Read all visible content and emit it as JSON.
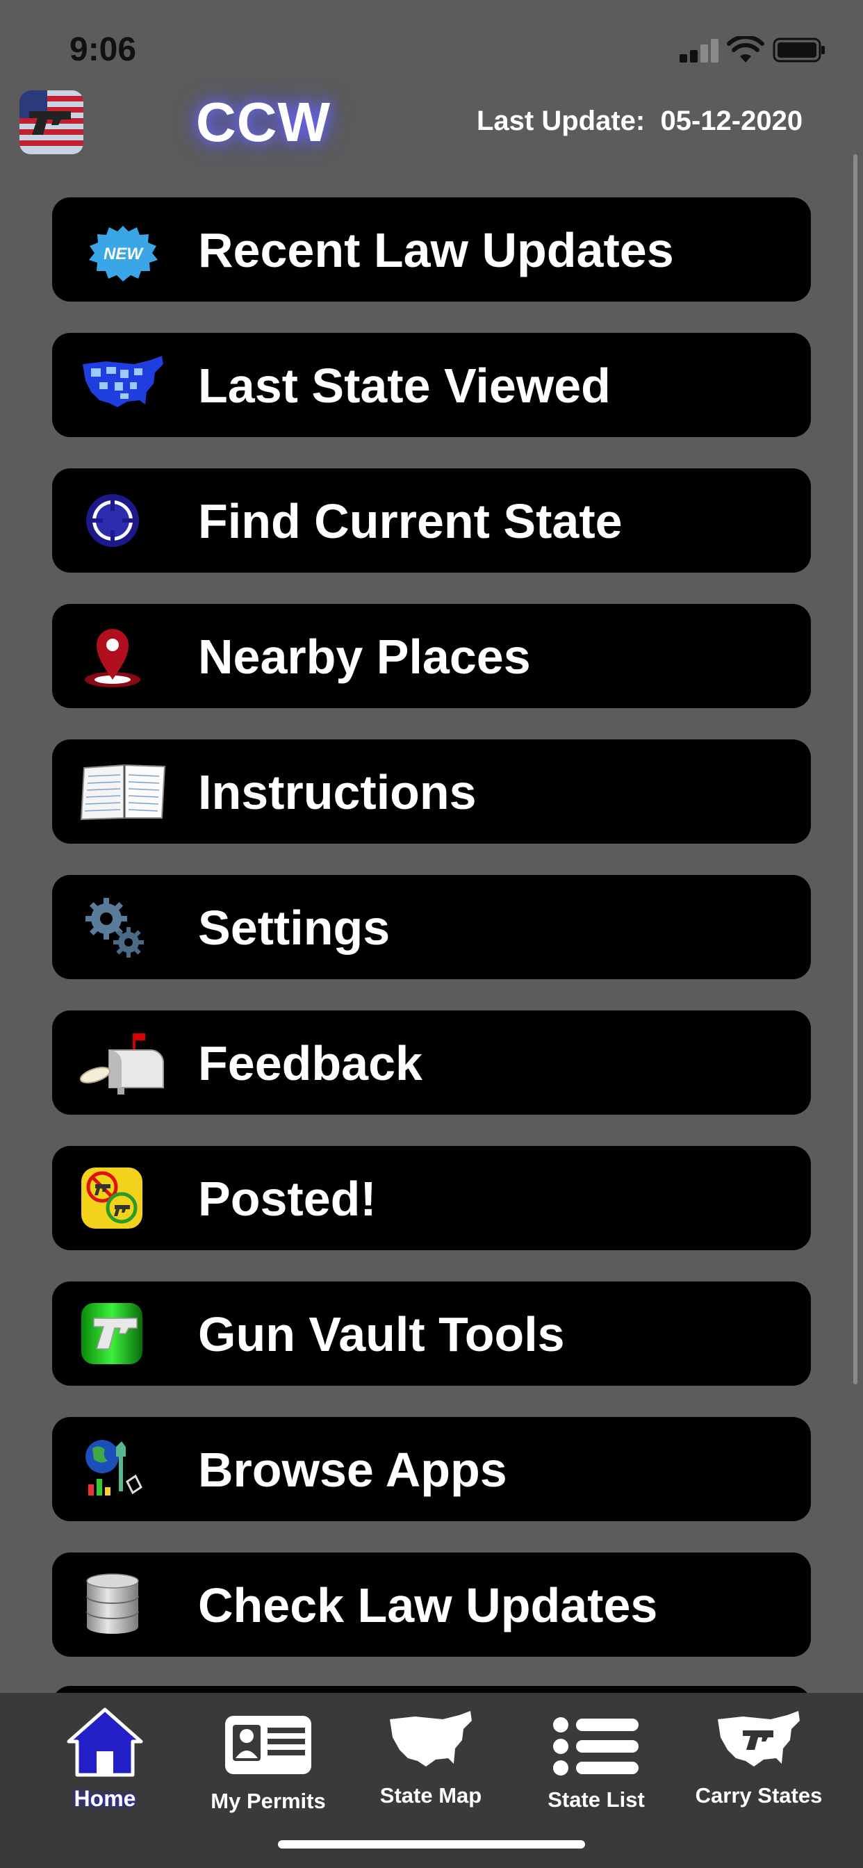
{
  "status_bar": {
    "time": "9:06"
  },
  "header": {
    "title": "CCW",
    "last_update": "Last Update:  05-12-2020"
  },
  "menu": [
    {
      "label": "Recent Law Updates",
      "icon": "new-badge-icon"
    },
    {
      "label": "Last State Viewed",
      "icon": "us-map-icon"
    },
    {
      "label": "Find Current State",
      "icon": "crosshair-icon"
    },
    {
      "label": "Nearby Places",
      "icon": "map-pin-icon"
    },
    {
      "label": "Instructions",
      "icon": "notebook-icon"
    },
    {
      "label": "Settings",
      "icon": "gears-icon"
    },
    {
      "label": "Feedback",
      "icon": "mailbox-icon"
    },
    {
      "label": "Posted!",
      "icon": "posted-sign-icon"
    },
    {
      "label": "Gun Vault Tools",
      "icon": "gun-vault-icon"
    },
    {
      "label": "Browse Apps",
      "icon": "apps-globe-icon"
    },
    {
      "label": "Check Law Updates",
      "icon": "database-icon"
    }
  ],
  "tab_bar": {
    "tabs": [
      {
        "label": "Home",
        "icon": "home-icon",
        "active": true
      },
      {
        "label": "My Permits",
        "icon": "id-card-icon",
        "active": false
      },
      {
        "label": "State Map",
        "icon": "us-silhouette-icon",
        "active": false
      },
      {
        "label": "State List",
        "icon": "list-icon",
        "active": false
      },
      {
        "label": "Carry States",
        "icon": "carry-states-icon",
        "active": false
      }
    ]
  },
  "colors": {
    "background": "#5c5c5c",
    "button": "#000000",
    "tab_bar": "#3a3a3a",
    "title_glow": "#6e6cff",
    "active_tab": "#2a28d8"
  }
}
